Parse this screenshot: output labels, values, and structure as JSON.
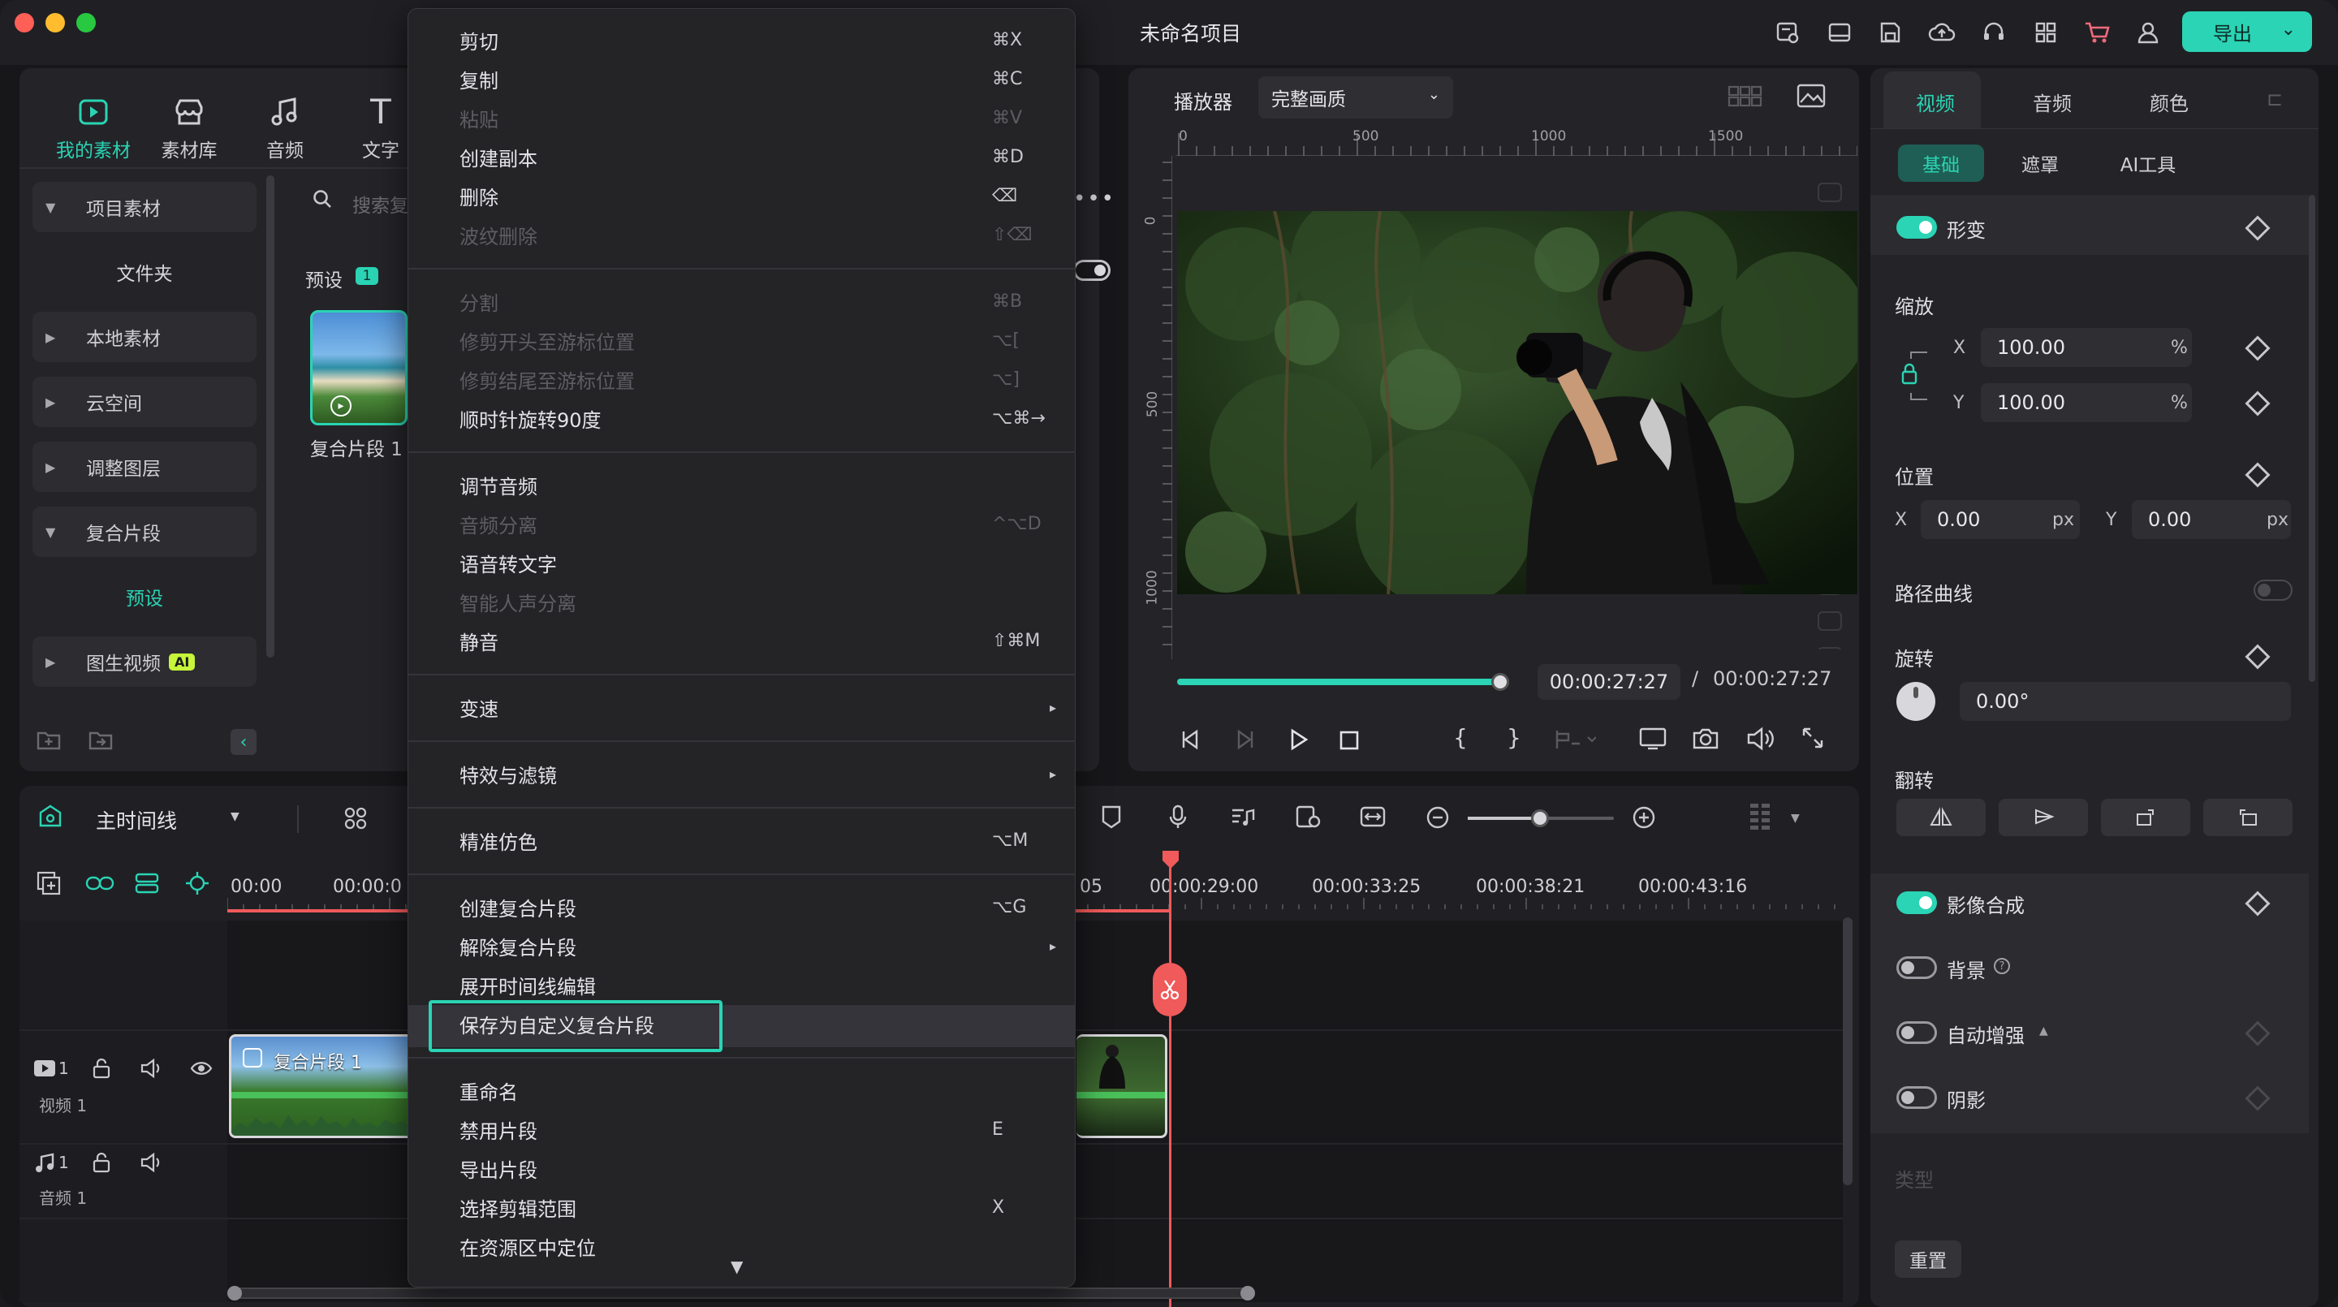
{
  "window": {
    "title": "未命名项目",
    "export_label": "导出"
  },
  "left_tabs": [
    {
      "label": "我的素材",
      "icon": "media-icon"
    },
    {
      "label": "素材库",
      "icon": "store-icon"
    },
    {
      "label": "音频",
      "icon": "music-icon"
    },
    {
      "label": "文字",
      "icon": "text-icon"
    }
  ],
  "sidebar": {
    "items": [
      {
        "label": "项目素材"
      },
      {
        "label": "文件夹"
      },
      {
        "label": "本地素材"
      },
      {
        "label": "云空间"
      },
      {
        "label": "调整图层"
      },
      {
        "label": "复合片段"
      },
      {
        "label": "预设"
      },
      {
        "label": "图生视频"
      }
    ],
    "ai_badge": "AI"
  },
  "media": {
    "search_placeholder": "搜索复",
    "preset_label": "预设",
    "preset_count": "1",
    "clip_name": "复合片段 1"
  },
  "context_menu": {
    "items": [
      {
        "label": "剪切",
        "shortcut": "⌘X",
        "enabled": true
      },
      {
        "label": "复制",
        "shortcut": "⌘C",
        "enabled": true
      },
      {
        "label": "粘贴",
        "shortcut": "⌘V",
        "enabled": false
      },
      {
        "label": "创建副本",
        "shortcut": "⌘D",
        "enabled": true
      },
      {
        "label": "删除",
        "shortcut": "⌫",
        "enabled": true
      },
      {
        "label": "波纹删除",
        "shortcut": "⇧⌫",
        "enabled": false
      },
      {
        "label": "分割",
        "shortcut": "⌘B",
        "enabled": false
      },
      {
        "label": "修剪开头至游标位置",
        "shortcut": "⌥[",
        "enabled": false
      },
      {
        "label": "修剪结尾至游标位置",
        "shortcut": "⌥]",
        "enabled": false
      },
      {
        "label": "顺时针旋转90度",
        "shortcut": "⌥⌘→",
        "enabled": true
      },
      {
        "label": "调节音频",
        "shortcut": "",
        "enabled": true
      },
      {
        "label": "音频分离",
        "shortcut": "^⌥D",
        "enabled": false
      },
      {
        "label": "语音转文字",
        "shortcut": "",
        "enabled": true
      },
      {
        "label": "智能人声分离",
        "shortcut": "",
        "enabled": false
      },
      {
        "label": "静音",
        "shortcut": "⇧⌘M",
        "enabled": true
      },
      {
        "label": "变速",
        "shortcut": "",
        "enabled": true
      },
      {
        "label": "特效与滤镜",
        "shortcut": "",
        "enabled": true
      },
      {
        "label": "精准仿色",
        "shortcut": "⌥M",
        "enabled": true
      },
      {
        "label": "创建复合片段",
        "shortcut": "⌥G",
        "enabled": true
      },
      {
        "label": "解除复合片段",
        "shortcut": "",
        "enabled": true
      },
      {
        "label": "展开时间线编辑",
        "shortcut": "",
        "enabled": true
      },
      {
        "label": "保存为自定义复合片段",
        "shortcut": "",
        "enabled": true
      },
      {
        "label": "重命名",
        "shortcut": "",
        "enabled": true
      },
      {
        "label": "禁用片段",
        "shortcut": "E",
        "enabled": true
      },
      {
        "label": "导出片段",
        "shortcut": "",
        "enabled": true
      },
      {
        "label": "选择剪辑范围",
        "shortcut": "X",
        "enabled": true
      },
      {
        "label": "在资源区中定位",
        "shortcut": "",
        "enabled": true
      }
    ],
    "highlighted": "保存为自定义复合片段"
  },
  "player": {
    "label": "播放器",
    "quality": "完整画质",
    "ruler_top": [
      "0",
      "500",
      "1000",
      "1500"
    ],
    "ruler_left": [
      "0",
      "500",
      "1000"
    ],
    "current_time": "00:00:27:27",
    "separator": "/",
    "total_time": "00:00:27:27",
    "progress": 1.0
  },
  "right_panel": {
    "tabs": [
      "视频",
      "音频",
      "颜色"
    ],
    "sub_tabs": [
      "基础",
      "遮罩",
      "AI工具"
    ],
    "transform_label": "形变",
    "scale_label": "缩放",
    "scale_x": "100.00",
    "scale_y": "100.00",
    "percent": "%",
    "position_label": "位置",
    "pos_x": "0.00",
    "pos_y": "0.00",
    "px": "px",
    "x_label": "X",
    "y_label": "Y",
    "path_curve_label": "路径曲线",
    "rotate_label": "旋转",
    "rotate_value": "0.00°",
    "flip_label": "翻转",
    "compositing_label": "影像合成",
    "background_label": "背景",
    "auto_enhance_label": "自动增强",
    "shadow_label": "阴影",
    "type_label": "类型",
    "reset_label": "重置"
  },
  "timeline": {
    "label": "主时间线",
    "ruler": [
      "00:00",
      "00:00:0",
      "05",
      "00:00:29:00",
      "00:00:33:25",
      "00:00:38:21",
      "00:00:43:16"
    ],
    "video_track": {
      "num": "1",
      "name": "视频 1"
    },
    "audio_track": {
      "num": "1",
      "name": "音频 1"
    },
    "clip_label": "复合片段 1"
  },
  "colors": {
    "accent": "#2ad4b4",
    "playhead": "#f05a5a",
    "background": "#17171a"
  }
}
